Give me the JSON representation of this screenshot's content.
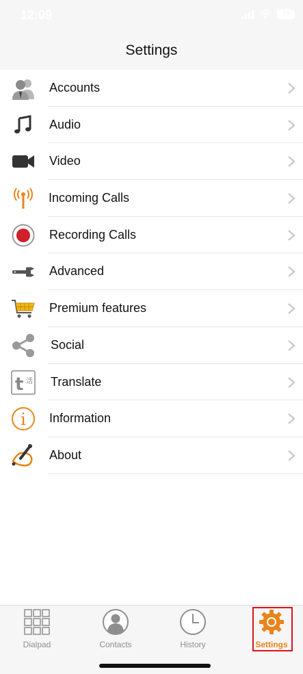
{
  "status_bar": {
    "time": "12:09",
    "battery": "76"
  },
  "header": {
    "title": "Settings"
  },
  "colors": {
    "accent": "#e8841a",
    "record": "#d0202a",
    "highlight": "#e0101a"
  },
  "settings": {
    "items": [
      {
        "label": "Accounts",
        "icon": "accounts-icon"
      },
      {
        "label": "Audio",
        "icon": "music-note-icon"
      },
      {
        "label": "Video",
        "icon": "video-camera-icon"
      },
      {
        "label": "Incoming Calls",
        "icon": "antenna-icon"
      },
      {
        "label": "Recording Calls",
        "icon": "record-icon"
      },
      {
        "label": "Advanced",
        "icon": "wrench-icon"
      },
      {
        "label": "Premium features",
        "icon": "shopping-cart-icon"
      },
      {
        "label": "Social",
        "icon": "share-icon"
      },
      {
        "label": "Translate",
        "icon": "translate-icon",
        "glyph_t": "t",
        "glyph_zh": "活"
      },
      {
        "label": "Information",
        "icon": "info-icon",
        "glyph": "i"
      },
      {
        "label": "About",
        "icon": "about-icon"
      }
    ]
  },
  "tabs": [
    {
      "label": "Dialpad",
      "icon": "dialpad-icon",
      "active": false
    },
    {
      "label": "Contacts",
      "icon": "contacts-icon",
      "active": false
    },
    {
      "label": "History",
      "icon": "clock-icon",
      "active": false
    },
    {
      "label": "Settings",
      "icon": "gear-icon",
      "active": true
    }
  ]
}
